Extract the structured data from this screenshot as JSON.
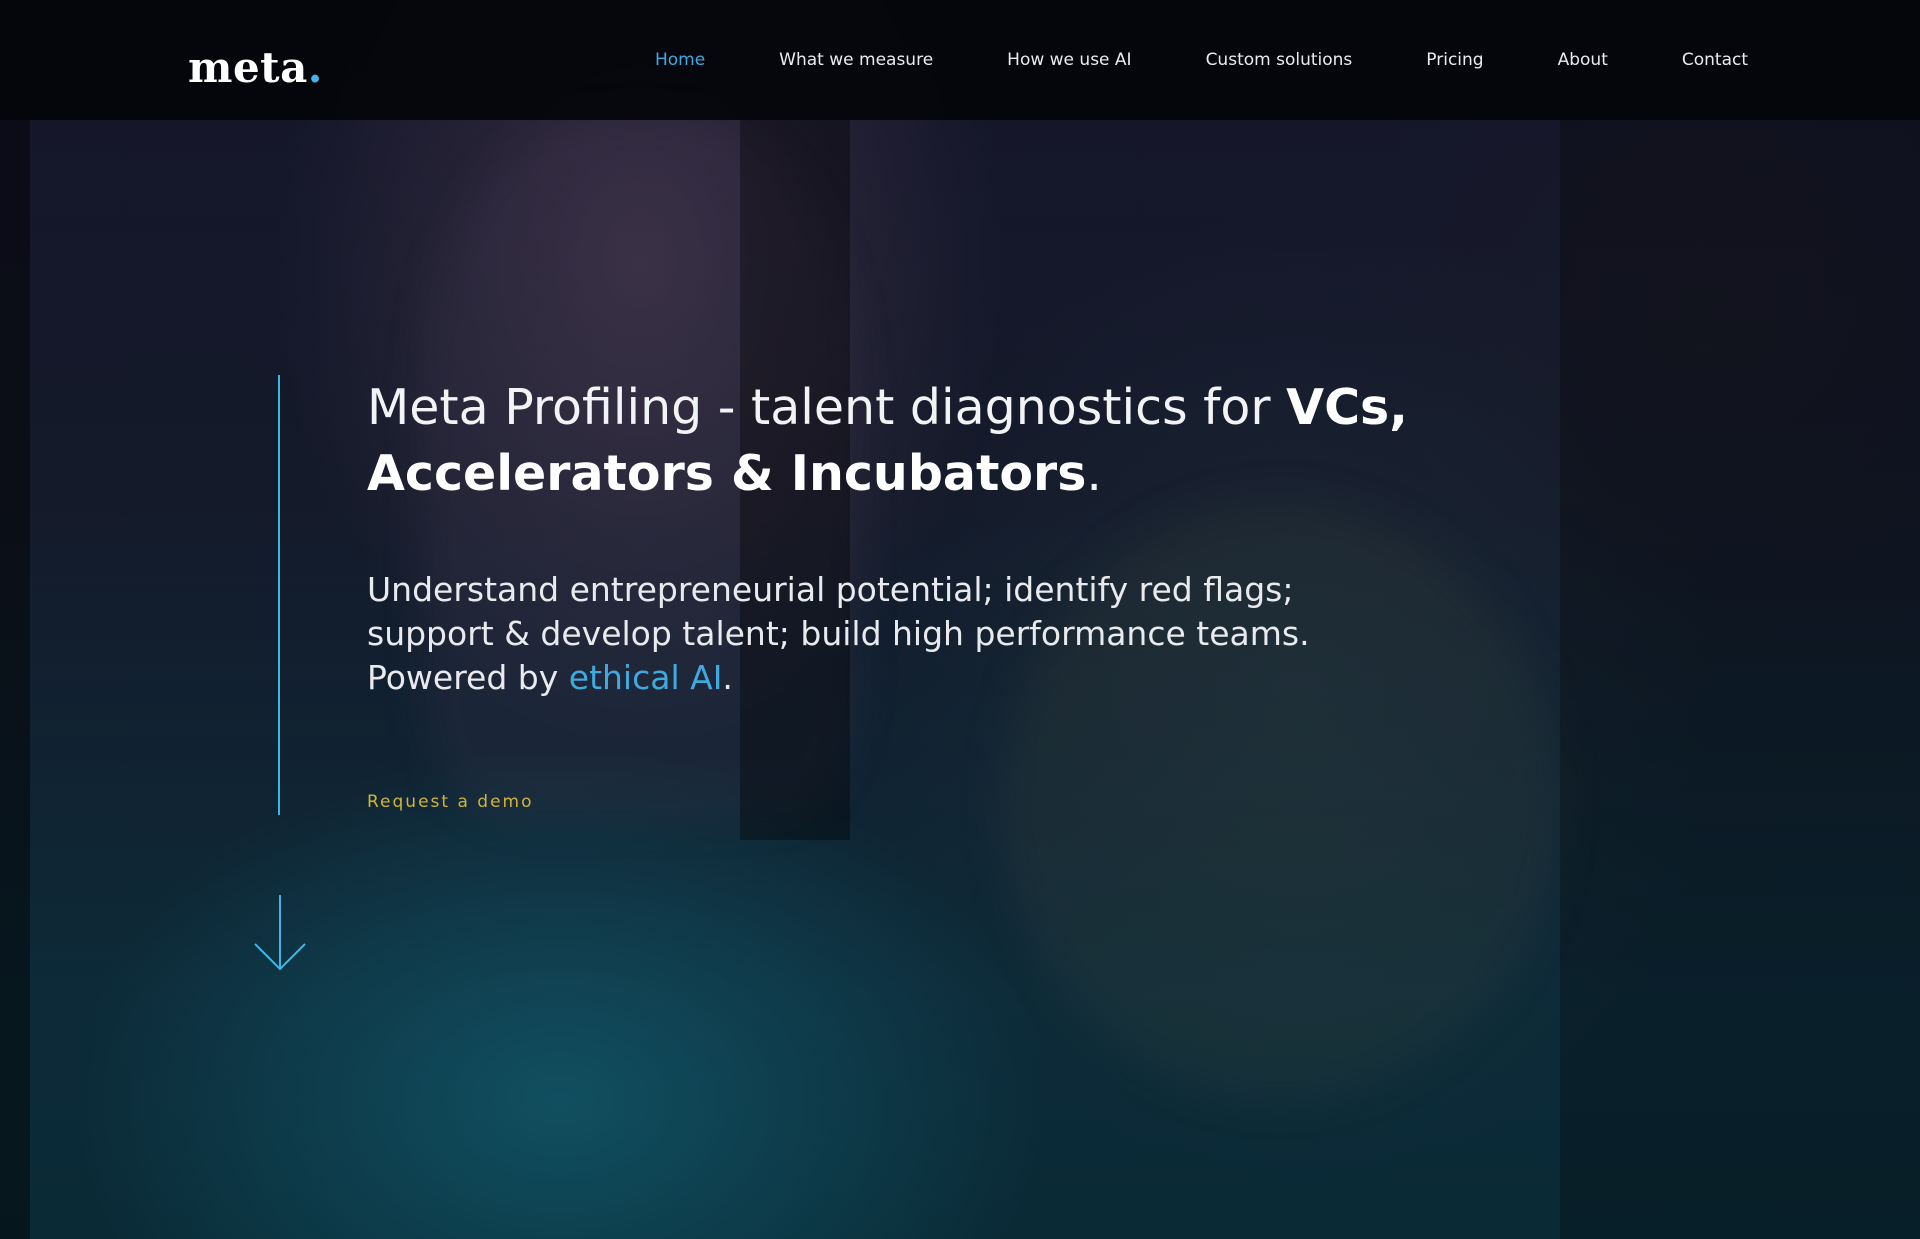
{
  "brand": {
    "logo_text": "meta",
    "logo_dot": ".",
    "accent_color": "#3fb6e6",
    "cta_color": "#d4b433"
  },
  "nav": {
    "items": [
      {
        "label": "Home",
        "active": true
      },
      {
        "label": "What we measure",
        "active": false
      },
      {
        "label": "How we use AI",
        "active": false
      },
      {
        "label": "Custom solutions",
        "active": false
      },
      {
        "label": "Pricing",
        "active": false
      },
      {
        "label": "About",
        "active": false
      },
      {
        "label": "Contact",
        "active": false
      }
    ]
  },
  "hero": {
    "title_part1": "Meta Profiling - talent diagnostics for ",
    "title_bold1": "VCs,",
    "title_bold2": "Accelerators & Incubators",
    "title_end": ".",
    "sub_line1": "Understand entrepreneurial potential; identify red flags;",
    "sub_line2": "support & develop talent; build high performance teams.",
    "sub_line3_prefix": "Powered by ",
    "sub_line3_link": "ethical AI",
    "sub_line3_suffix": ".",
    "cta_label": "Request a demo",
    "scroll_icon": "arrow-down-icon"
  }
}
